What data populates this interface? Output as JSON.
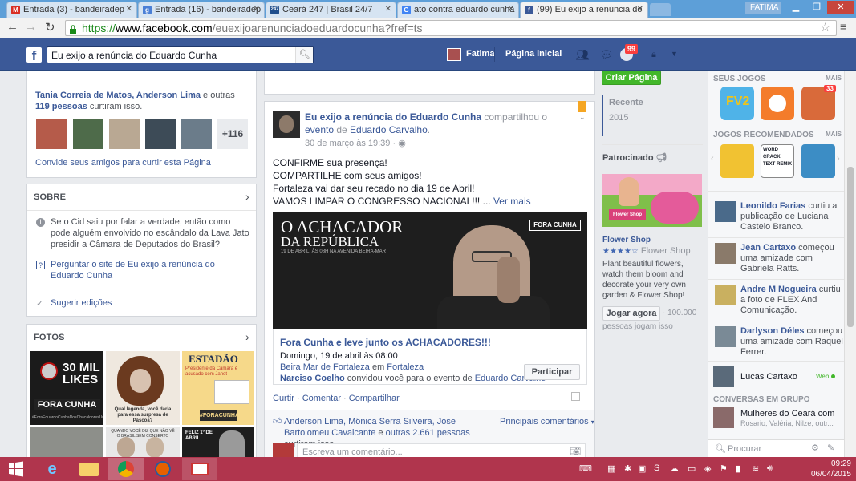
{
  "browser": {
    "tabs": [
      {
        "title": "Entrada (3) - bandeiradep",
        "favicon": "gmail-icon",
        "fav_text": "M",
        "fav_color": "#d93025"
      },
      {
        "title": "Entrada (16) - bandeiradep",
        "favicon": "google-apps-icon",
        "fav_text": "g",
        "fav_color": "#4a7fd6"
      },
      {
        "title": "Ceará 247 | Brasil 24/7",
        "favicon": "ceara247-icon",
        "fav_text": "247",
        "fav_color": "#1f4e8c"
      },
      {
        "title": "ato contra eduardo cunha",
        "favicon": "google-search-icon",
        "fav_text": "G",
        "fav_color": "#4285f4"
      },
      {
        "title": "(99) Eu exijo a renúncia do",
        "favicon": "facebook-icon",
        "fav_text": "f",
        "fav_color": "#3b5998"
      }
    ],
    "user": "FATIMA",
    "url_scheme": "https://",
    "url_host": "www.facebook.com",
    "url_path": "/euexijoarenunciadoeduardocunha?fref=ts"
  },
  "fbbar": {
    "search_value": "Eu exijo a renúncia do Eduardo Cunha",
    "profile_name": "Fatima",
    "home_label": "Página inicial",
    "notif_count": "99"
  },
  "left": {
    "likers_names": "Tania Correia de Matos, Anderson Lima",
    "likers_mid": " e outras ",
    "likers_count": "119 pessoas",
    "likers_tail": " curtiram isso.",
    "more_count": "+116",
    "invite": "Convide seus amigos para curtir esta Página",
    "about_title": "SOBRE",
    "about_text": "Se o Cid saiu por falar a verdade, então como pode alguém envolvido no escândalo da Lava Jato presidir a Câmara de Deputados do Brasil?",
    "ask": "Perguntar o site de Eu exijo a renúncia do Eduardo Cunha",
    "suggest": "Sugerir edições",
    "photos_title": "FOTOS",
    "photo1_big": "30 MIL LIKES",
    "photo1_band": "FORA CUNHA",
    "photo1_small": "#ForaEduardoCunhaDosChacaldoresUnidos",
    "photo2_caption": "Qual legenda, você daria para essa surpresa de Páscoa?",
    "photo3_title": "ESTADÃO",
    "photo3_sub": "Presidente da Câmara é acusado com Janot",
    "photo3_tag": "#FORACUNHA",
    "photo5_text": "QUANDO VOCÊ DIZ QUE NÃO VÊ O BRASIL SEM CONSERTO",
    "photo6_text": "FELIZ 1º DE ABRIL"
  },
  "post": {
    "page_name": "Eu exijo a renúncia do Eduardo Cunha",
    "shared_text": " compartilhou o ",
    "event_word": "evento",
    "of_text": " de ",
    "author": "Eduardo Carvalho",
    "date": "30 de março às 19:39",
    "line1": "CONFIRME sua presença!",
    "line2": "COMPARTILHE com seus amigos!",
    "line3": "Fortaleza vai dar seu recado no dia 19 de Abril!",
    "line4": "VAMOS LIMPAR O CONGRESSO NACIONAL!!! ...",
    "see_more": "Ver mais",
    "img_title1": "O ACHACADOR",
    "img_title2": "DA REPÚBLICA",
    "img_sub": "19 DE ABRIL, ÀS 08H NA AVENIDA BEIRA-MAR",
    "img_tag": "FORA CUNHA",
    "event_title": "Fora Cunha e leve junto os ACHACADORES!!!",
    "event_date": "Domingo, 19 de abril às 08:00",
    "event_place": "Beira Mar de Fortaleza",
    "event_in": " em ",
    "event_city": "Fortaleza",
    "inviter": "Narciso Coelho",
    "invited_text": " convidou você para o evento de ",
    "inviter_target": "Eduardo Carvalho",
    "join": "Participar",
    "like": "Curtir",
    "comment": "Comentar",
    "share": "Compartilhar",
    "likes_names": "Anderson Lima, Mônica Serra Silveira, Jose Bartolomeu Cavalcante",
    "likes_and": " e ",
    "likes_others": "outras 2.661 pessoas",
    "likes_tail": " curtiram isso.",
    "top_comments": "Principais comentários",
    "comment_placeholder": "Escreva um comentário..."
  },
  "mid": {
    "create_page": "Criar Página",
    "recent": "Recente",
    "year": "2015",
    "sponsored": "Patrocinado",
    "ad_title": "Flower Shop",
    "ad_name": "Flower Shop",
    "ad_rating": 4,
    "ad_text": "Plant beautiful flowers, watch them bloom and decorate your very own garden & Flower Shop!",
    "ad_btn": "Jogar agora",
    "ad_players": "100.000",
    "ad_players_tail": "pessoas jogam isso",
    "ad_logo": "Flower Shop"
  },
  "right": {
    "my_games": "SEUS JOGOS",
    "more1": "MAIS",
    "game_badge": "33",
    "recommended": "JOGOS RECOMENDADOS",
    "more2": "MAIS",
    "rec2_text": "WORD CRACK TEXT REMIX",
    "ticker": [
      {
        "name": "Leonildo Farias",
        "text": " curtiu a publicação de Luciana Castelo Branco."
      },
      {
        "name": "Jean Cartaxo",
        "text": " começou uma amizade com Gabriela Ratts."
      },
      {
        "name": "Andre M Nogueira",
        "text": " curtiu a foto de FLEX And Comunicação."
      },
      {
        "name": "Darlyson Déles",
        "text": " começou uma amizade com Raquel Ferrer."
      }
    ],
    "chat_name": "Lucas Cartaxo",
    "chat_status": "Web",
    "groups_title": "CONVERSAS EM GRUPO",
    "group_name": "Mulheres do Ceará com",
    "group_members": "Rosario, Valéria, Nilze, outr...",
    "search_placeholder": "Procurar"
  },
  "taskbar": {
    "time": "09:29",
    "date": "06/04/2015"
  },
  "colors": {
    "fb_blue": "#3b5998",
    "green": "#42b72a",
    "taskbar": "#b0354d"
  }
}
